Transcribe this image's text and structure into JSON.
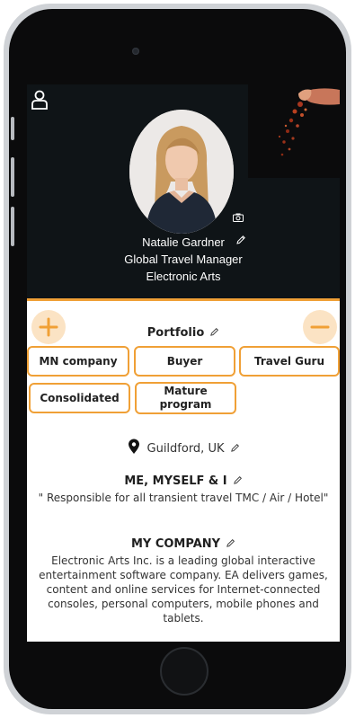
{
  "profile": {
    "name": "Natalie Gardner",
    "title": "Global Travel Manager",
    "company": "Electronic Arts"
  },
  "actions": {
    "add_symbol": "+",
    "remove_symbol": "−"
  },
  "portfolio": {
    "title": "Portfolio",
    "tags": [
      "MN company",
      "Buyer",
      "Travel Guru",
      "Consolidated",
      "Mature program"
    ]
  },
  "location": "Guildford, UK",
  "about": {
    "title": "ME, MYSELF & I",
    "text": "\" Responsible for all transient travel TMC / Air / Hotel\""
  },
  "my_company": {
    "title": "MY COMPANY",
    "text": "Electronic Arts Inc. is a leading global interactive entertainment software company. EA delivers games, content and online services for Internet-connected consoles, personal computers, mobile phones and tablets."
  },
  "colors": {
    "accent": "#f0a036",
    "header_bg": "#0f1417",
    "button_bg": "#fbe3c4"
  },
  "icons": [
    "user-icon",
    "camera-icon",
    "pencil-icon",
    "plus-icon",
    "minus-icon",
    "location-pin-icon"
  ]
}
